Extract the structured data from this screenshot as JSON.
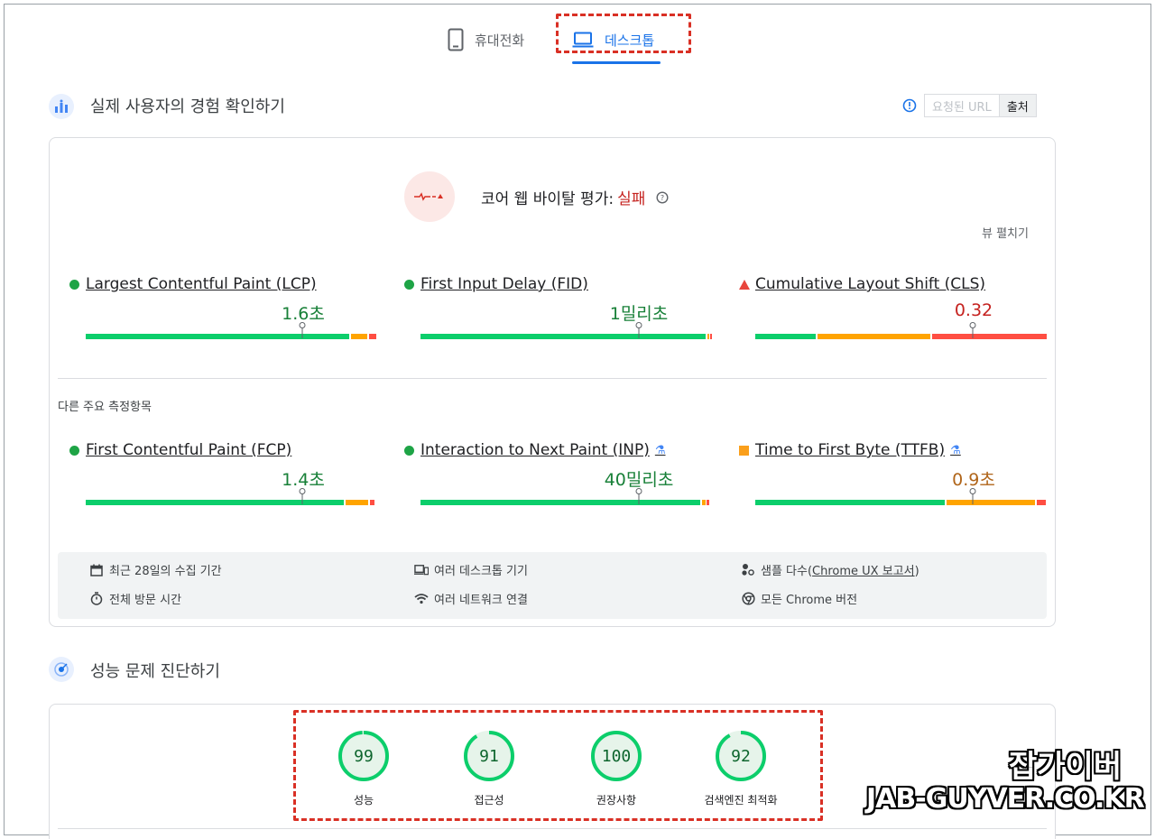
{
  "tabs": {
    "mobile": "휴대전화",
    "desktop": "데스크톱"
  },
  "field_section": {
    "title": "실제 사용자의 경험 확인하기",
    "url_toggle": {
      "url_label": "요청된 URL",
      "origin_label": "출처"
    },
    "cwv": {
      "label": "코어 웹 바이탈 평가:",
      "result": "실패"
    },
    "expand_label": "뷰 펼치기",
    "core_metrics": [
      {
        "name": "Largest Contentful Paint (LCP)",
        "value": "1.6초",
        "status": "good"
      },
      {
        "name": "First Input Delay (FID)",
        "value": "1밀리초",
        "status": "good"
      },
      {
        "name": "Cumulative Layout Shift (CLS)",
        "value": "0.32",
        "status": "poor"
      }
    ],
    "other_label": "다른 주요 측정항목",
    "other_metrics": [
      {
        "name": "First Contentful Paint (FCP)",
        "value": "1.4초",
        "status": "good"
      },
      {
        "name": "Interaction to Next Paint (INP)",
        "value": "40밀리초",
        "status": "good",
        "experimental": true
      },
      {
        "name": "Time to First Byte (TTFB)",
        "value": "0.9초",
        "status": "average",
        "experimental": true
      }
    ],
    "info": {
      "period": "최근 28일의 수집 기간",
      "visit": "전체 방문 시간",
      "devices": "여러 데스크톱 기기",
      "network": "여러 네트워크 연결",
      "samples_prefix": "샘플 다수(",
      "samples_link": "Chrome UX 보고서",
      "samples_suffix": ")",
      "versions": "모든 Chrome 버전"
    }
  },
  "lab_section": {
    "title": "성능 문제 진단하기",
    "scores": [
      {
        "value": "99",
        "label": "성능",
        "fraction": 0.99
      },
      {
        "value": "91",
        "label": "접근성",
        "fraction": 0.91
      },
      {
        "value": "100",
        "label": "권장사항",
        "fraction": 1.0
      },
      {
        "value": "92",
        "label": "검색엔진 최적화",
        "fraction": 0.92
      }
    ]
  },
  "watermark": {
    "line1": "잡가이버",
    "line2": "JAB-GUYVER.CO.KR"
  },
  "colors": {
    "accent": "#1a73e8",
    "good": "#0cce6b",
    "average": "#ffa400",
    "poor": "#ff4e42",
    "highlight": "#d93025"
  }
}
